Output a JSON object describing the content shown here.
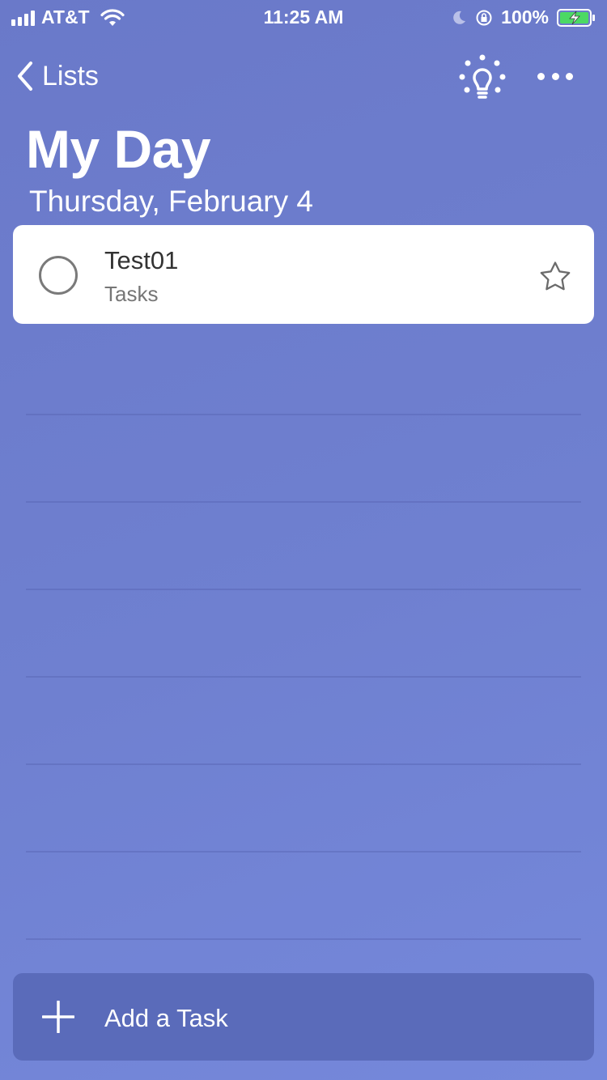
{
  "status_bar": {
    "carrier": "AT&T",
    "time": "11:25 AM",
    "battery_percent": "100%",
    "icons": [
      "signal-icon",
      "wifi-icon",
      "moon-icon",
      "rotation-lock-icon",
      "battery-charging-icon"
    ]
  },
  "nav": {
    "back_label": "Lists",
    "icons": [
      "chevron-left-icon",
      "lightbulb-icon",
      "more-icon"
    ]
  },
  "header": {
    "title": "My Day",
    "date": "Thursday, February 4"
  },
  "tasks": [
    {
      "title": "Test01",
      "list": "Tasks",
      "completed": false,
      "starred": false
    }
  ],
  "add_task": {
    "label": "Add a Task"
  },
  "colors": {
    "background": "#6f80d0",
    "add_task_bar": "#5a6bba",
    "card": "#ffffff",
    "battery_fill": "#4cd964"
  }
}
